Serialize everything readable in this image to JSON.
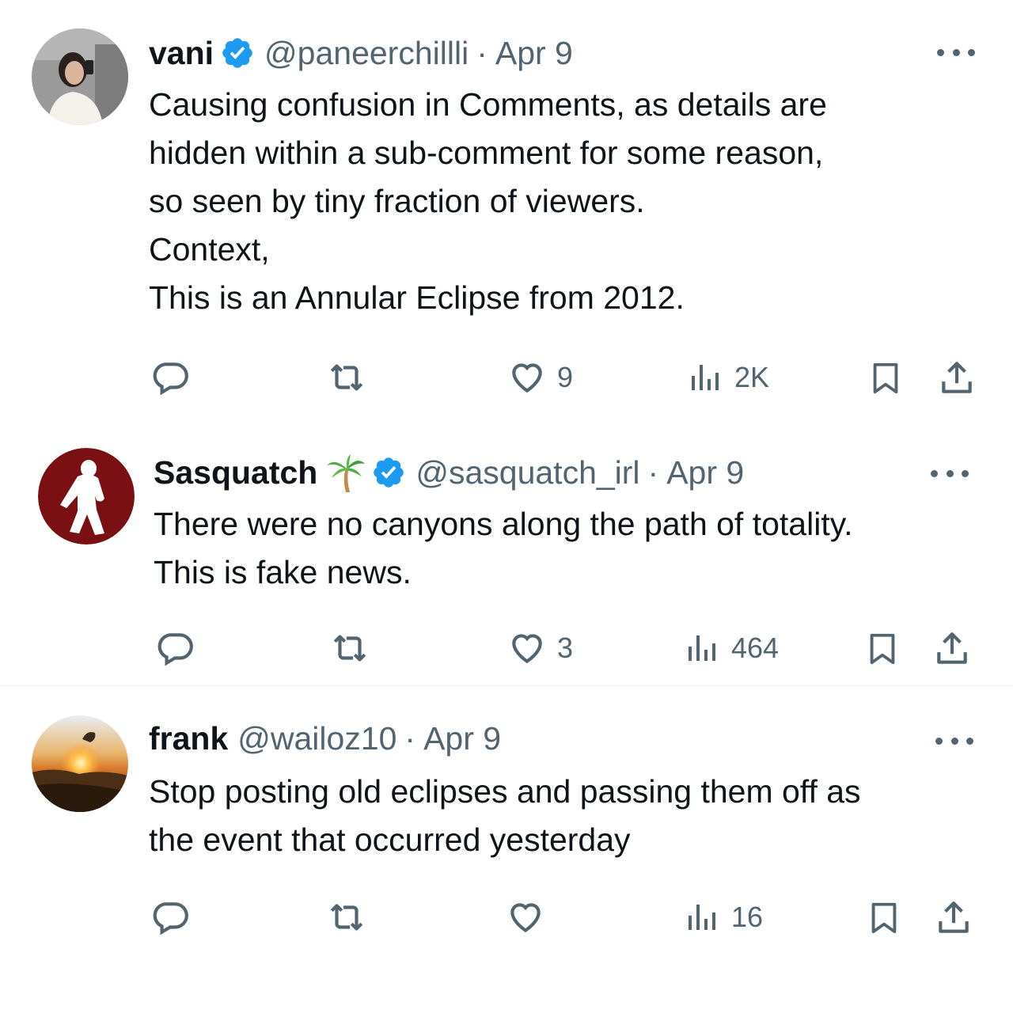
{
  "tweets": [
    {
      "name": "vani",
      "verified": true,
      "handle": "@paneerchillli",
      "separator": "·",
      "date": "Apr 9",
      "lines": [
        "Causing confusion in Comments, as details are",
        "hidden within a sub-comment for some reason,",
        "so seen by tiny fraction of viewers.",
        "Context,",
        "This is an Annular Eclipse from 2012."
      ],
      "likes": "9",
      "views": "2K"
    },
    {
      "name": "Sasquatch",
      "name_emoji": "palm-tree",
      "verified": true,
      "handle": "@sasquatch_irl",
      "separator": "·",
      "date": "Apr 9",
      "lines": [
        "There were no canyons along the path of totality.",
        "This is fake news."
      ],
      "likes": "3",
      "views": "464"
    },
    {
      "name": "frank",
      "verified": false,
      "handle": "@wailoz10",
      "separator": "·",
      "date": "Apr 9",
      "lines": [
        "Stop posting old eclipses and passing them off as",
        "the event that occurred yesterday"
      ],
      "likes": "",
      "views": "16"
    }
  ],
  "colors": {
    "text": "#0f1419",
    "secondary": "#536471",
    "verified_blue": "#1d9bf0",
    "sasquatch_bg": "#7a0f14"
  }
}
